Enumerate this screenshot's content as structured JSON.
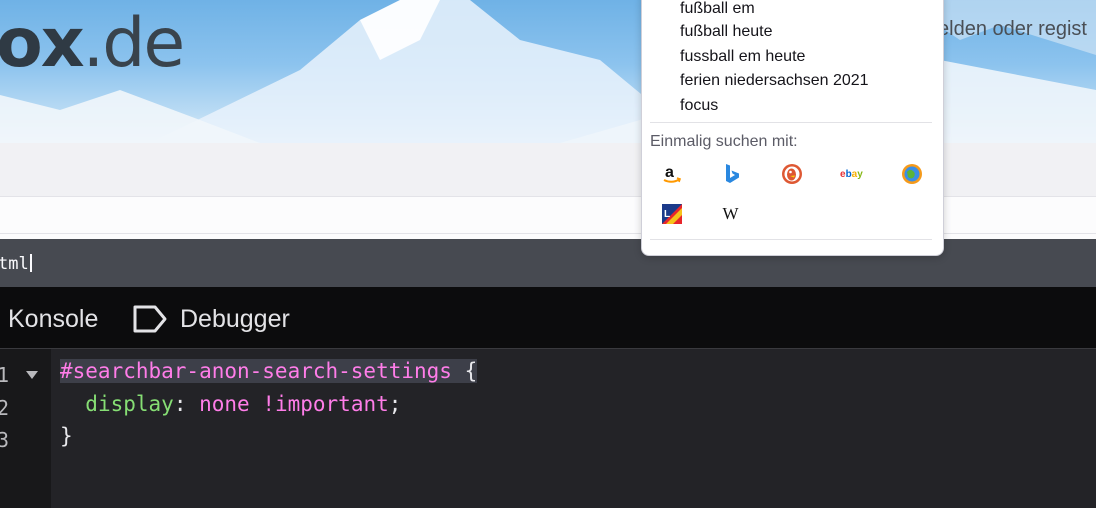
{
  "website": {
    "logo_bold": "ox",
    "logo_light": ".de",
    "login_text": "elden oder regist"
  },
  "search_popup": {
    "suggestions": [
      "fußball em",
      "fußball heute",
      "fussball em heute",
      "ferien niedersachsen 2021",
      "focus"
    ],
    "one_time_label": "Einmalig suchen mit:",
    "engines": [
      {
        "icon": "amazon-icon",
        "glyph": "a"
      },
      {
        "icon": "bing-icon",
        "glyph": "b"
      },
      {
        "icon": "duckduckgo-icon",
        "glyph": ""
      },
      {
        "icon": "ebay-icon",
        "glyph": "ebay"
      },
      {
        "icon": "ecosia-icon",
        "glyph": ""
      },
      {
        "icon": "leo-icon",
        "glyph": ""
      },
      {
        "icon": "wikipedia-icon",
        "glyph": "W"
      }
    ]
  },
  "devtools": {
    "title_fragment": "tml",
    "tabs": {
      "console": "Konsole",
      "debugger": "Debugger"
    },
    "editor": {
      "line_numbers": [
        "1",
        "2",
        "3"
      ],
      "line1_selector": "#searchbar-anon-search-settings",
      "line1_brace": " {",
      "line2_property": "display",
      "line2_colon": ": ",
      "line2_value": "none !important",
      "line2_semicolon": ";",
      "line3": "}"
    }
  },
  "colors": {
    "devtools_title_bg": "#474a51",
    "devtools_tabs_bg": "#0c0c0d",
    "editor_bg": "#232327",
    "selector_color": "#ff7de9",
    "property_color": "#86de74"
  }
}
